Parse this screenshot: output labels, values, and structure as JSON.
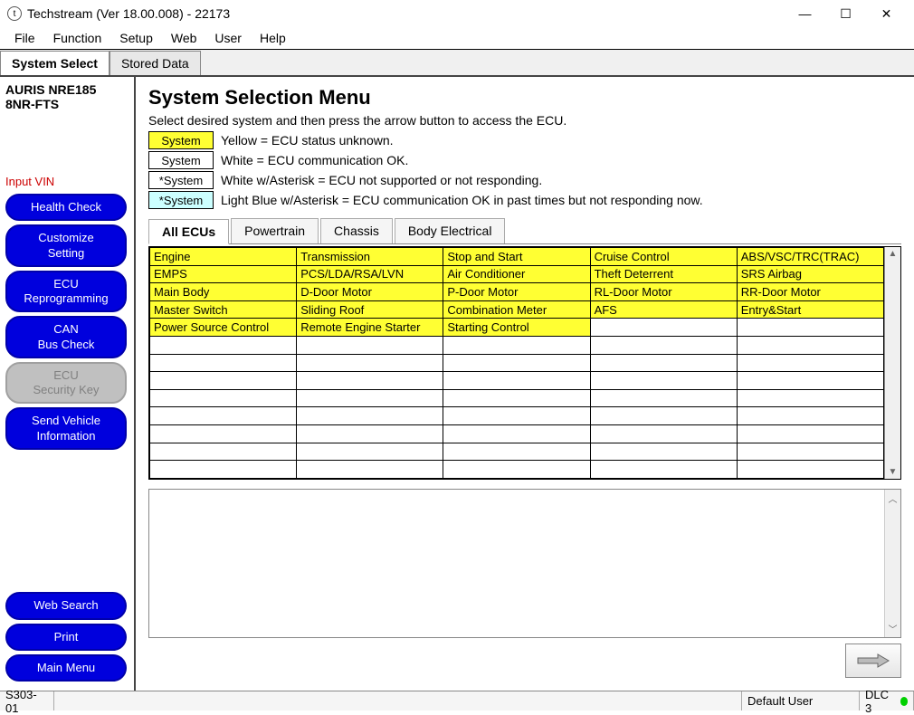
{
  "window": {
    "title": "Techstream (Ver 18.00.008) - 22173"
  },
  "menubar": [
    "File",
    "Function",
    "Setup",
    "Web",
    "User",
    "Help"
  ],
  "topTabs": [
    {
      "label": "System Select",
      "active": true
    },
    {
      "label": "Stored Data",
      "active": false
    }
  ],
  "vehicle": {
    "line1": "AURIS NRE185",
    "line2": "8NR-FTS"
  },
  "inputVin": "Input VIN",
  "sidebarButtons": [
    {
      "label": "Health Check",
      "disabled": false
    },
    {
      "label": "Customize\nSetting",
      "disabled": false
    },
    {
      "label": "ECU\nReprogramming",
      "disabled": false
    },
    {
      "label": "CAN\nBus Check",
      "disabled": false
    },
    {
      "label": "ECU\nSecurity Key",
      "disabled": true
    },
    {
      "label": "Send Vehicle\nInformation",
      "disabled": false
    }
  ],
  "sidebarBottom": [
    "Web Search",
    "Print",
    "Main Menu"
  ],
  "heading": "System Selection Menu",
  "subheading": "Select desired system and then press the arrow button to access the ECU.",
  "legend": [
    {
      "swatch": "System",
      "bg": "#ffff33",
      "text": "Yellow = ECU status unknown."
    },
    {
      "swatch": "System",
      "bg": "#ffffff",
      "text": "White = ECU communication OK."
    },
    {
      "swatch": "*System",
      "bg": "#ffffff",
      "text": "White w/Asterisk = ECU not supported or not responding."
    },
    {
      "swatch": "*System",
      "bg": "#ccffff",
      "text": "Light Blue w/Asterisk = ECU communication OK in past times but not responding now."
    }
  ],
  "ecuTabs": [
    {
      "label": "All ECUs",
      "active": true
    },
    {
      "label": "Powertrain",
      "active": false
    },
    {
      "label": "Chassis",
      "active": false
    },
    {
      "label": "Body Electrical",
      "active": false
    }
  ],
  "grid": [
    [
      "Engine",
      "Transmission",
      "Stop and Start",
      "Cruise Control",
      "ABS/VSC/TRC(TRAC)"
    ],
    [
      "EMPS",
      "PCS/LDA/RSA/LVN",
      "Air Conditioner",
      "Theft Deterrent",
      "SRS Airbag"
    ],
    [
      "Main Body",
      "D-Door Motor",
      "P-Door Motor",
      "RL-Door Motor",
      "RR-Door Motor"
    ],
    [
      "Master Switch",
      "Sliding Roof",
      "Combination Meter",
      "AFS",
      "Entry&Start"
    ],
    [
      "Power Source Control",
      "Remote Engine Starter",
      "Starting Control",
      "",
      ""
    ],
    [
      "",
      "",
      "",
      "",
      ""
    ],
    [
      "",
      "",
      "",
      "",
      ""
    ],
    [
      "",
      "",
      "",
      "",
      ""
    ],
    [
      "",
      "",
      "",
      "",
      ""
    ],
    [
      "",
      "",
      "",
      "",
      ""
    ],
    [
      "",
      "",
      "",
      "",
      ""
    ],
    [
      "",
      "",
      "",
      "",
      ""
    ],
    [
      "",
      "",
      "",
      "",
      ""
    ]
  ],
  "status": {
    "code": "S303-01",
    "user": "Default User",
    "dlc": "DLC 3"
  }
}
